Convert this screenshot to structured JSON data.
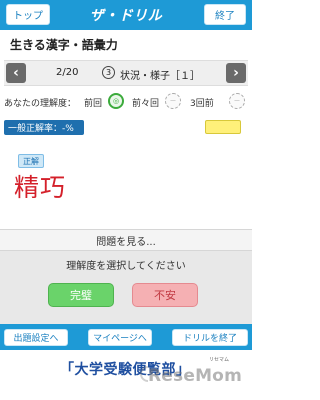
{
  "header": {
    "top_label": "トップ",
    "logo_text": "ザ・ドリル",
    "end_label": "終了"
  },
  "subject": "生きる漢字・語彙力",
  "navigator": {
    "prev_symbol": "‹",
    "next_symbol": "›",
    "counter": "2/20",
    "number_mark": "3",
    "topic": "状況・様子［１］"
  },
  "understanding": {
    "label": "あなたの理解度：",
    "history": [
      {
        "label": "前回",
        "icon": "face-good-icon",
        "icon_text": "◎",
        "color": "#3cab3c"
      },
      {
        "label": "前々回",
        "icon": "face-empty-icon",
        "icon_text": "－",
        "color": "#aaaaaa"
      },
      {
        "label": "3回前",
        "icon": "face-empty-icon",
        "icon_text": "－",
        "color": "#aaaaaa"
      }
    ]
  },
  "correct_rate": "一般正解率：-%",
  "answer": {
    "tag": "正解",
    "text": "精巧"
  },
  "reveal_question": "問題を見る...",
  "rating": {
    "title": "理解度を選択してください",
    "good_label": "完璧",
    "bad_label": "不安"
  },
  "footer": {
    "settings_label": "出題設定へ",
    "mypage_label": "マイページへ",
    "finish_label": "ドリルを終了"
  },
  "banner": {
    "brand": "「大学受験便覧部」",
    "brand_sub": "リセマム",
    "watermark": "ReseMom"
  },
  "colors": {
    "primary": "#1e9ad6",
    "answer_red": "#d4202a",
    "good_green": "#6ad36a",
    "bad_pink": "#f5b0b3",
    "rate_badge": "#1f6fae"
  }
}
